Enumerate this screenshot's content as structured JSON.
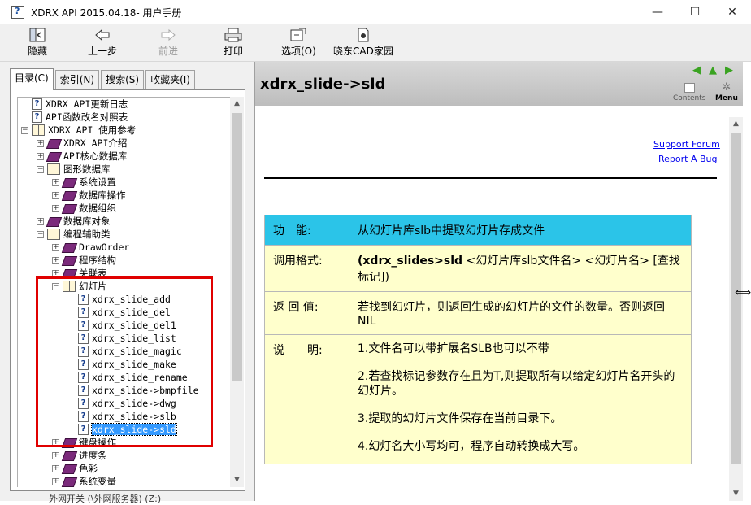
{
  "window": {
    "title": "XDRX API 2015.04.18- 用户手册",
    "minimize": "—",
    "maximize": "☐",
    "close": "✕"
  },
  "toolbar": {
    "hide": "隐藏",
    "back": "上一步",
    "forward": "前进",
    "print": "打印",
    "options": "选项(O)",
    "home": "晓东CAD家园"
  },
  "tabs": [
    "目录(C)",
    "索引(N)",
    "搜索(S)",
    "收藏夹(I)"
  ],
  "tree": [
    {
      "indent": 0,
      "type": "page",
      "label": "XDRX API更新日志"
    },
    {
      "indent": 0,
      "type": "page",
      "label": "API函数改名对照表"
    },
    {
      "indent": 0,
      "type": "open",
      "label": "XDRX API 使用参考"
    },
    {
      "indent": 1,
      "type": "closed",
      "label": "XDRX API介绍"
    },
    {
      "indent": 1,
      "type": "closed",
      "label": "API核心数据库"
    },
    {
      "indent": 1,
      "type": "open",
      "label": "图形数据库"
    },
    {
      "indent": 2,
      "type": "closed",
      "label": "系统设置"
    },
    {
      "indent": 2,
      "type": "closed",
      "label": "数据库操作"
    },
    {
      "indent": 2,
      "type": "closed",
      "label": "数据组织"
    },
    {
      "indent": 1,
      "type": "closed",
      "label": "数据库对象"
    },
    {
      "indent": 1,
      "type": "open",
      "label": "编程辅助类"
    },
    {
      "indent": 2,
      "type": "closed",
      "label": "DrawOrder"
    },
    {
      "indent": 2,
      "type": "closed",
      "label": "程序结构"
    },
    {
      "indent": 2,
      "type": "closed",
      "label": "关联表"
    },
    {
      "indent": 2,
      "type": "open",
      "label": "幻灯片"
    },
    {
      "indent": 3,
      "type": "page",
      "label": "xdrx_slide_add"
    },
    {
      "indent": 3,
      "type": "page",
      "label": "xdrx_slide_del"
    },
    {
      "indent": 3,
      "type": "page",
      "label": "xdrx_slide_del1"
    },
    {
      "indent": 3,
      "type": "page",
      "label": "xdrx_slide_list"
    },
    {
      "indent": 3,
      "type": "page",
      "label": "xdrx_slide_magic"
    },
    {
      "indent": 3,
      "type": "page",
      "label": "xdrx_slide_make"
    },
    {
      "indent": 3,
      "type": "page",
      "label": "xdrx_slide_rename"
    },
    {
      "indent": 3,
      "type": "page",
      "label": "xdrx_slide->bmpfile"
    },
    {
      "indent": 3,
      "type": "page",
      "label": "xdrx_slide->dwg"
    },
    {
      "indent": 3,
      "type": "page",
      "label": "xdrx_slide->slb"
    },
    {
      "indent": 3,
      "type": "page",
      "label": "xdrx_slide->sld",
      "selected": true
    },
    {
      "indent": 2,
      "type": "closed",
      "label": "键盘操作"
    },
    {
      "indent": 2,
      "type": "closed",
      "label": "进度条"
    },
    {
      "indent": 2,
      "type": "closed",
      "label": "色彩"
    },
    {
      "indent": 2,
      "type": "closed",
      "label": "系统变量"
    }
  ],
  "status_fragment": "外网开关 (\\外网服务器) (Z:)",
  "topic": {
    "title": "xdrx_slide->sld",
    "contents_label": "Contents",
    "menu_label": "Menu",
    "support_link": "Support Forum",
    "bug_link": "Report A Bug"
  },
  "table": {
    "func_label": "功　能:",
    "func_value": "从幻灯片库slb中提取幻灯片存成文件",
    "format_label": "调用格式:",
    "format_cmd": "(xdrx_slides>sld",
    "format_args": " <幻灯片库slb文件名> <幻灯片名> [查找标记])",
    "return_label": "返 回 值:",
    "return_value": "若找到幻灯片，则返回生成的幻灯片的文件的数量。否则返回NIL",
    "desc_label": "说　　明:",
    "desc_items": [
      "1.文件名可以带扩展名SLB也可以不带",
      "2.若查找标记参数存在且为T,则提取所有以给定幻灯片名开头的幻灯片。",
      "3.提取的幻灯片文件保存在当前目录下。",
      "4.幻灯名大小写均可，程序自动转换成大写。"
    ]
  },
  "colors": {
    "function_row": "#2bc4e8",
    "body_rows": "#ffffcc",
    "highlight_box": "#e00000",
    "selection": "#3399ff"
  }
}
